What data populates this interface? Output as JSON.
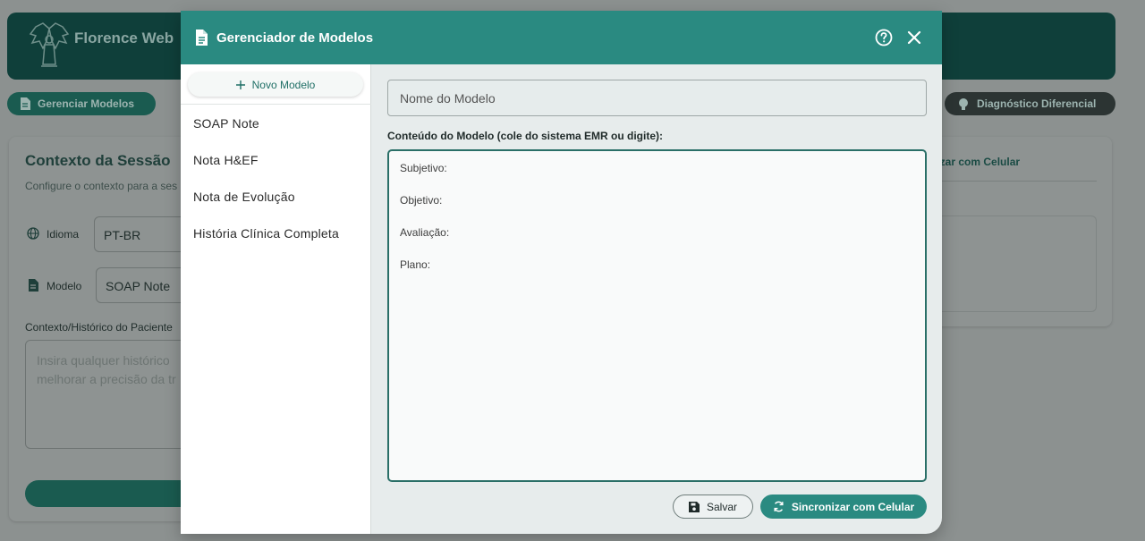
{
  "background": {
    "app_title": "Florence Web",
    "manage_button": "Gerenciar Modelos",
    "diagnosis_button": "Diagnóstico Diferencial",
    "context_title": "Contexto da Sessão",
    "context_subtitle": "Configure o contexto para a ses",
    "language_label": "Idioma",
    "language_value": "PT-BR",
    "model_label": "Modelo",
    "model_value": "SOAP Note",
    "patient_label": "Contexto/Histórico do Paciente",
    "patient_placeholder": "Insira qualquer histórico melhorar a precisão da tr",
    "sync_tab": "nizar com Celular"
  },
  "modal": {
    "title": "Gerenciador de Modelos",
    "new_model_label": "Novo Modelo",
    "models": [
      {
        "label": "SOAP Note"
      },
      {
        "label": "Nota H&EF"
      },
      {
        "label": "Nota de Evolução"
      },
      {
        "label": "História Clínica Completa"
      }
    ],
    "name_placeholder": "Nome do Modelo",
    "content_label": "Conteúdo do Modelo (cole do sistema EMR ou digite):",
    "template_lines": [
      "Subjetivo:",
      "Objetivo:",
      "Avaliação:",
      "Plano:"
    ],
    "save_label": "Salvar",
    "sync_label": "Sincronizar com Celular"
  },
  "colors": {
    "accent": "#2a8a81",
    "header_dark": "#0f3f3a",
    "overlay": "#8c9190"
  },
  "icons": [
    "document-icon",
    "help-icon",
    "close-icon",
    "plus-icon",
    "save-icon",
    "sync-icon",
    "globe-icon",
    "brain-icon",
    "logo-emblem"
  ]
}
